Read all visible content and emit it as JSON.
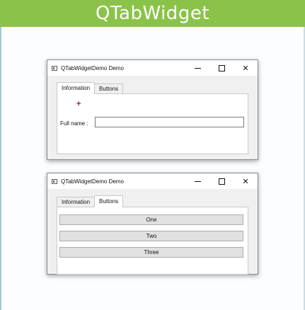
{
  "banner": {
    "title": "QTabWidget"
  },
  "window1": {
    "title": "QTabWidgetDemo Demo",
    "controls": {
      "minimize": "–",
      "close": "✕"
    },
    "tabs": [
      {
        "label": "Information"
      },
      {
        "label": "Buttons"
      }
    ],
    "active_tab": "Information",
    "cursor": "+",
    "fullname_label": "Full name :",
    "fullname_value": ""
  },
  "window2": {
    "title": "QTabWidgetDemo Demo",
    "controls": {
      "minimize": "–",
      "close": "✕"
    },
    "tabs": [
      {
        "label": "Information"
      },
      {
        "label": "Buttons"
      }
    ],
    "active_tab": "Buttons",
    "buttons": [
      {
        "label": "One"
      },
      {
        "label": "Two"
      },
      {
        "label": "Three"
      }
    ]
  },
  "colors": {
    "banner": "#8bc34a",
    "window_bg": "#f0f0f0",
    "button_bg": "#e1e1e1"
  }
}
